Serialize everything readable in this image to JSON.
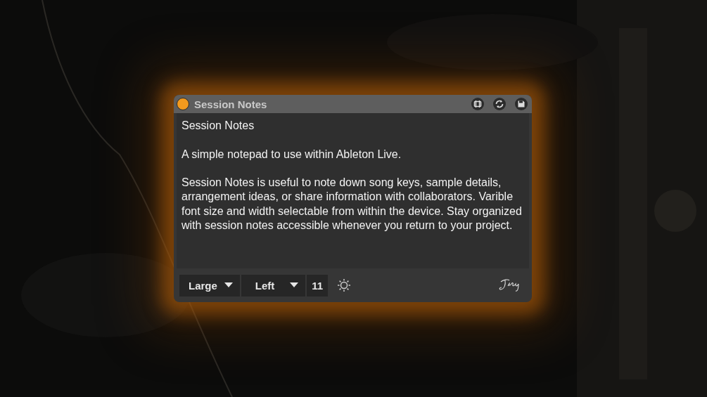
{
  "window": {
    "title": "Session Notes"
  },
  "notes": [
    "Session Notes",
    "A simple notepad to use within Ableton Live.",
    "Session Notes is useful to note down song keys, sample details, arrangement ideas, or share information with collaborators. Varible font size and width selectable from within the device. Stay organized with session notes accessible whenever you return to your project."
  ],
  "toolbar": {
    "size": "Large",
    "align": "Left",
    "font_size": "11"
  }
}
